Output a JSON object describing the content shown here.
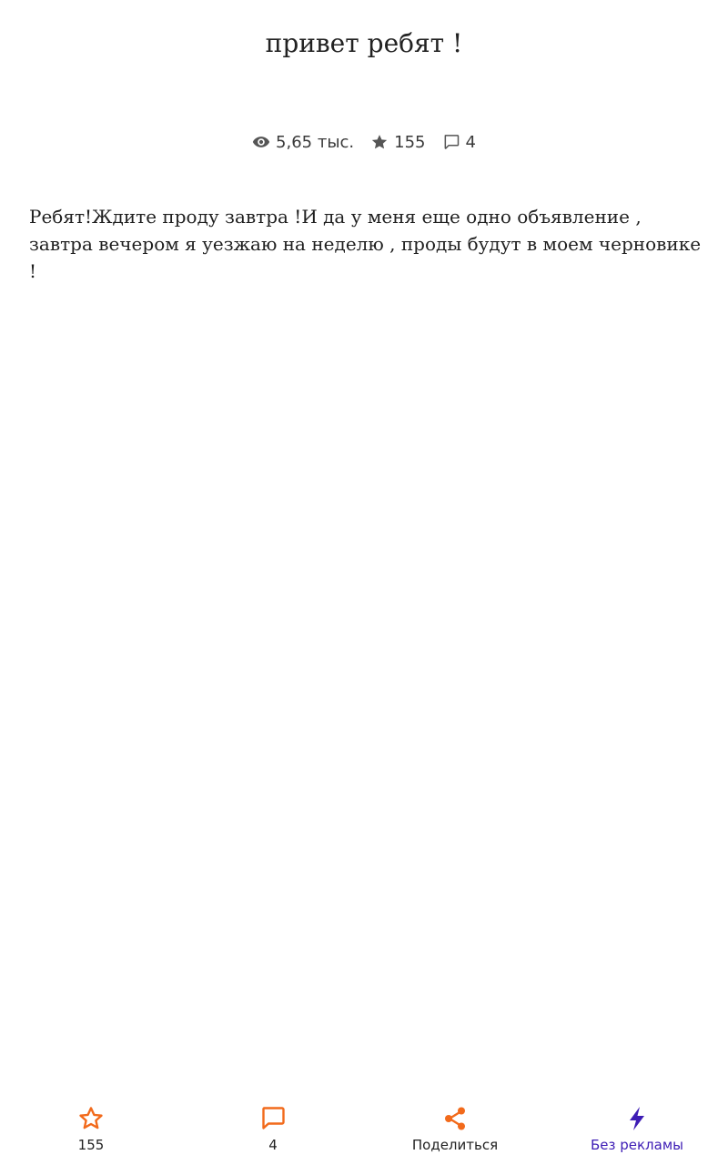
{
  "story": {
    "title": "привет ребят !",
    "body": "Ребят!Ждите проду завтра !И да у меня еще одно объявление , завтра вечером я уезжаю на неделю , проды будут в моем черновике !"
  },
  "stats": {
    "views": "5,65 тыс.",
    "stars": "155",
    "comments": "4"
  },
  "bottom_bar": {
    "star_count": "155",
    "comment_count": "4",
    "share_label": "Поделиться",
    "no_ads_label": "Без рекламы"
  },
  "colors": {
    "accent_orange": "#f26a1b",
    "accent_purple": "#3d1cb5",
    "stat_gray": "#555555"
  },
  "icons": [
    "eye-icon",
    "star-icon",
    "comment-icon",
    "share-icon",
    "lightning-icon"
  ]
}
